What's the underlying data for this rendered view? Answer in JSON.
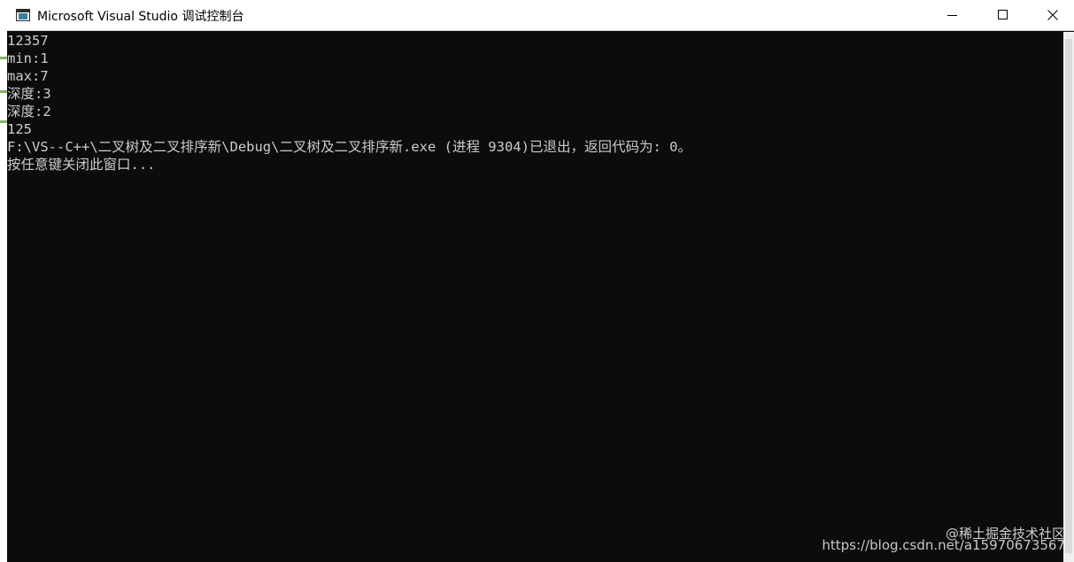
{
  "window": {
    "title": "Microsoft Visual Studio 调试控制台",
    "icon": "console-app-icon",
    "controls": {
      "minimize": "minimize-icon",
      "maximize": "maximize-icon",
      "close": "close-icon"
    }
  },
  "console": {
    "lines": [
      "12357",
      "min:1",
      "max:7",
      "深度:3",
      "深度:2",
      "125",
      "F:\\VS--C++\\二叉树及二叉排序新\\Debug\\二叉树及二叉排序新.exe (进程 9304)已退出，返回代码为: 0。",
      "按任意键关闭此窗口..."
    ]
  },
  "watermark": "https://blog.csdn.net/a15970673567",
  "watermark_brand": "@稀土掘金技术社区",
  "colors": {
    "console_bg": "#0c0c0c",
    "console_text": "#cccccc",
    "titlebar_bg": "#ffffff"
  }
}
